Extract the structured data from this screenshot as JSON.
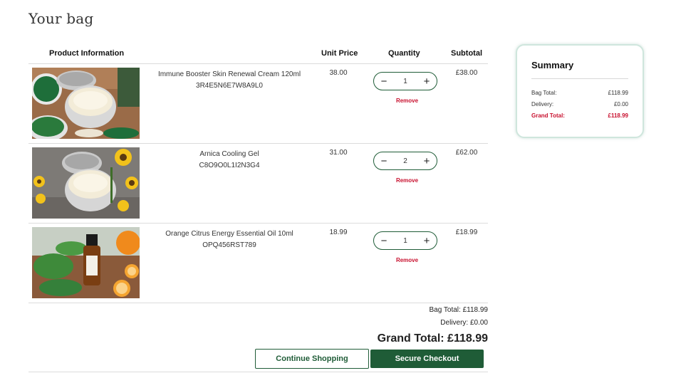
{
  "page_title": "Your bag",
  "table_headers": {
    "product": "Product Information",
    "unit_price": "Unit Price",
    "quantity": "Quantity",
    "subtotal": "Subtotal"
  },
  "items": [
    {
      "name": "Immune Booster Skin Renewal Cream 120ml",
      "sku": "3R4E5N6E7W8A9L0",
      "unit_price": "38.00",
      "quantity": "1",
      "subtotal": "£38.00",
      "remove_label": "Remove",
      "image": "cream-jar-green-powder"
    },
    {
      "name": "Arnica Cooling Gel",
      "sku": "C8O9O0L1I2N3G4",
      "unit_price": "31.00",
      "quantity": "2",
      "subtotal": "£62.00",
      "remove_label": "Remove",
      "image": "cream-jar-yellow-flowers"
    },
    {
      "name": "Orange Citrus Energy Essential Oil 10ml",
      "sku": "OPQ456RST789",
      "unit_price": "18.99",
      "quantity": "1",
      "subtotal": "£18.99",
      "remove_label": "Remove",
      "image": "oil-bottle-oranges-mint"
    }
  ],
  "totals": {
    "bag_total": "Bag Total: £118.99",
    "delivery": "Delivery: £0.00",
    "grand_total": "Grand Total: £118.99"
  },
  "buttons": {
    "continue": "Continue Shopping",
    "checkout": "Secure Checkout"
  },
  "stepper": {
    "minus": "−",
    "plus": "+"
  },
  "summary": {
    "title": "Summary",
    "bag_total_label": "Bag Total:",
    "bag_total_value": "£118.99",
    "delivery_label": "Delivery:",
    "delivery_value": "£0.00",
    "grand_total_label": "Grand Total:",
    "grand_total_value": "£118.99"
  },
  "colors": {
    "brand_green": "#1f5c37",
    "remove_red": "#c8102e",
    "summary_border": "#cfe6dd"
  }
}
